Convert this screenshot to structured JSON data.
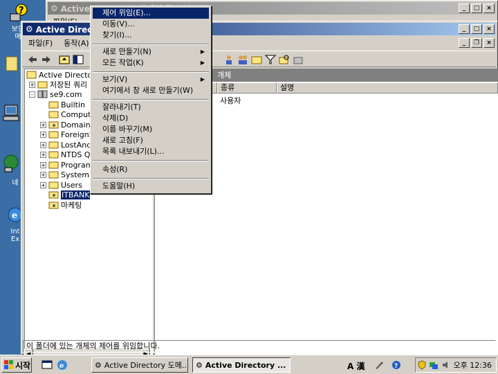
{
  "desktop": {
    "icons": [
      {
        "label": "보안\n매",
        "icon": "help-icon"
      },
      {
        "label": "내",
        "icon": "my-documents-icon"
      },
      {
        "label": "내 ",
        "icon": "my-computer-icon"
      },
      {
        "label": "내 네",
        "icon": "my-network-icon"
      },
      {
        "label": "Int\nEx",
        "icon": "internet-explorer-icon"
      }
    ]
  },
  "back_window": {
    "title": "Active Directory 도메인 및 트러스트",
    "menu": "파일(F)"
  },
  "main_window": {
    "title": "Active Directory 사용자 및 컴퓨터",
    "menu": [
      "파일(F)",
      "동작(A)"
    ],
    "tree": [
      {
        "label": "Active Directory 사용자 및 컴퓨터",
        "level": 0,
        "exp": ""
      },
      {
        "label": "저장된 쿼리",
        "level": 1,
        "exp": "+"
      },
      {
        "label": "se9.com",
        "level": 1,
        "exp": "-"
      },
      {
        "label": "Builtin",
        "level": 2,
        "exp": ""
      },
      {
        "label": "Computers",
        "level": 2,
        "exp": ""
      },
      {
        "label": "Domain Controllers",
        "level": 2,
        "exp": "+"
      },
      {
        "label": "ForeignSecurityPrincipals",
        "level": 2,
        "exp": "+"
      },
      {
        "label": "LostAndFound",
        "level": 2,
        "exp": "+"
      },
      {
        "label": "NTDS Quotas",
        "level": 2,
        "exp": "+"
      },
      {
        "label": "Program Data",
        "level": 2,
        "exp": "+"
      },
      {
        "label": "System",
        "level": 2,
        "exp": "+"
      },
      {
        "label": "Users",
        "level": 2,
        "exp": "+"
      },
      {
        "label": "ITBANK",
        "level": 2,
        "exp": "",
        "selected": true
      },
      {
        "label": "마케팅",
        "level": 2,
        "exp": ""
      }
    ],
    "pane_title": "개체",
    "columns": [
      "이름",
      "종류",
      "설명"
    ],
    "rows": [
      {
        "name": "",
        "type": "사용자",
        "desc": ""
      }
    ],
    "status": "이 폴더에 있는 개체의 제어를 위임합니다."
  },
  "context_menu": {
    "items": [
      {
        "label": "제어 위임(E)...",
        "highlight": true
      },
      {
        "label": "이동(V)..."
      },
      {
        "label": "찾기(I)..."
      },
      {
        "sep": true
      },
      {
        "label": "새로 만들기(N)",
        "submenu": true
      },
      {
        "label": "모든 작업(K)",
        "submenu": true
      },
      {
        "sep": true
      },
      {
        "label": "보기(V)",
        "submenu": true
      },
      {
        "label": "여기에서 창 새로 만들기(W)"
      },
      {
        "sep": true
      },
      {
        "label": "잘라내기(T)"
      },
      {
        "label": "삭제(D)"
      },
      {
        "label": "이름 바꾸기(M)"
      },
      {
        "label": "새로 고침(F)"
      },
      {
        "label": "목록 내보내기(L)..."
      },
      {
        "sep": true
      },
      {
        "label": "속성(R)"
      },
      {
        "sep": true
      },
      {
        "label": "도움말(H)"
      }
    ]
  },
  "taskbar": {
    "start": "시작",
    "tasks": [
      "Active Directory 도메...",
      "Active Directory ..."
    ],
    "tray_ime": "A 漢",
    "clock": "오후 12:36"
  },
  "colors": {
    "desktop": "#3a6ea5",
    "title_active": "#0a246a",
    "highlight": "#0a246a"
  }
}
